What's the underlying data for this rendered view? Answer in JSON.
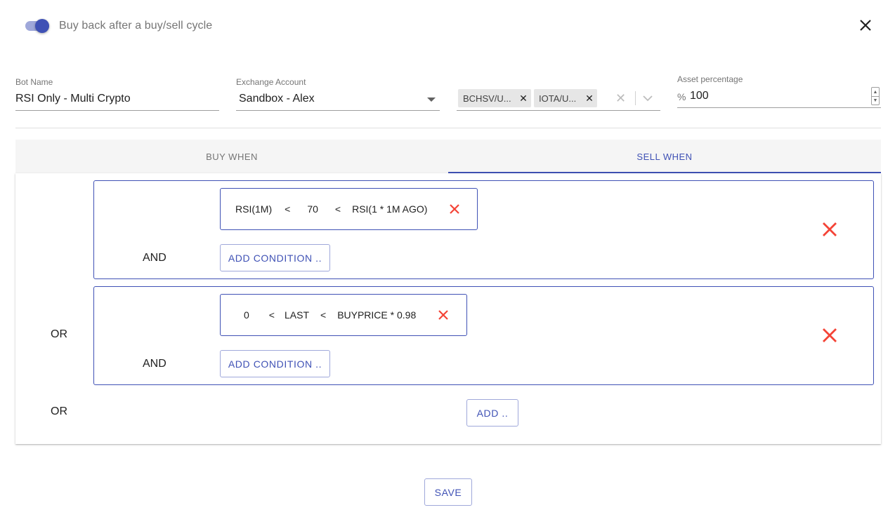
{
  "toggle": {
    "label": "Buy back after a buy/sell cycle",
    "checked": true
  },
  "form": {
    "bot_name_label": "Bot Name",
    "bot_name_value": "RSI Only - Multi Crypto",
    "exchange_label": "Exchange Account",
    "exchange_value": "Sandbox - Alex",
    "pairs": [
      {
        "label": "BCHSV/U..."
      },
      {
        "label": "IOTA/U..."
      }
    ],
    "asset_label": "Asset percentage",
    "asset_prefix": "%",
    "asset_value": "100"
  },
  "tabs": [
    {
      "label": "BUY WHEN",
      "active": false
    },
    {
      "label": "SELL WHEN",
      "active": true
    }
  ],
  "groups": [
    {
      "condition": {
        "left": "RSI(1M)",
        "op1": "<",
        "mid": "70",
        "op2": "<",
        "right": "RSI(1 * 1M AGO)"
      },
      "and_label": "AND",
      "add_label": "ADD CONDITION .."
    },
    {
      "condition": {
        "left": "0",
        "op1": "<",
        "mid": "LAST",
        "op2": "<",
        "right": "BUYPRICE * 0.98"
      },
      "and_label": "AND",
      "add_label": "ADD CONDITION .."
    }
  ],
  "or_labels": [
    "OR",
    "OR"
  ],
  "add_group_label": "ADD ..",
  "save_label": "SAVE",
  "colors": {
    "primary": "#3f51b5",
    "danger": "#f44336",
    "muted": "#757575"
  },
  "icons": {
    "close": "close-icon",
    "delete": "delete-icon",
    "chevron": "chevron-down-icon"
  }
}
